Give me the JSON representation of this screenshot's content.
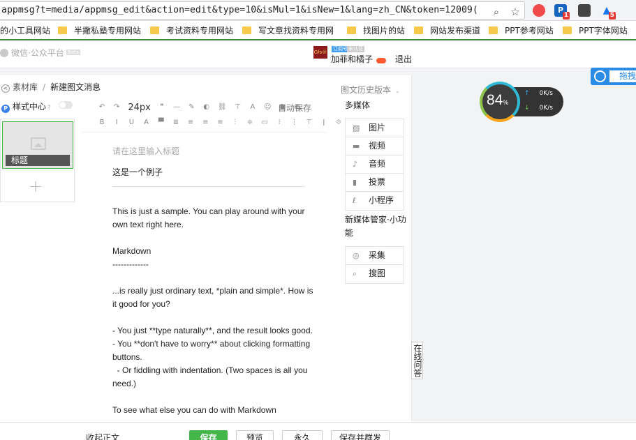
{
  "browser": {
    "url": "appmsg?t=media/appmsg_edit&action=edit&type=10&isMul=1&isNew=1&lang=zh_CN&token=12009(",
    "search_icon": "search-icon",
    "star_icon": "star-icon",
    "ext_p_label": "P",
    "ext_p_badge": "1",
    "ext_a_badge": "5"
  },
  "bookmarks": [
    "的小工具网站",
    "半撇私塾专用网站",
    "考试资料专用网站",
    "写文章找资料专用网",
    "找图片的站",
    "网站发布渠道",
    "PPT参考网站",
    "PPT字体网站"
  ],
  "header": {
    "logo_text": "微信·公众平台",
    "logo_tag": "Beta",
    "avatar_text": "Gfs®",
    "account_tag": "订阅号",
    "account_tag2": "未认证",
    "account_name": "加菲和橘子",
    "logout_label": "退出"
  },
  "breadcrumb": {
    "parent": "素材库",
    "separator": "/",
    "current": "新建图文消息"
  },
  "style_center": {
    "label": "样式中心",
    "help": "?",
    "p_icon": "P"
  },
  "thumbs": {
    "caption": "标题",
    "add": "+"
  },
  "toolbar": {
    "undo": "↶",
    "redo": "↷",
    "font_size": "24px",
    "row1": [
      "❞",
      "—",
      "✎",
      "◐",
      "⛓",
      "⊤",
      "A",
      "☺",
      "▣",
      "⊞"
    ],
    "row2": [
      "B",
      "I",
      "U",
      "A",
      "▀",
      "≣",
      "≡",
      "≡",
      "≡",
      "⫶",
      "≑",
      "▭",
      "⁝",
      "⋮",
      "⊤",
      "ǀ",
      "⟐"
    ],
    "autosave_label": "自动保存"
  },
  "editor": {
    "title_placeholder": "请在这里输入标题",
    "title_value": "这是一个例子",
    "body": "This is just a sample. You can play around with your own text right here.\n\nMarkdown\n-------------\n\n...is really just ordinary text, *plain and simple*. How is it good for you?\n\n- You just **type naturally**, and the result looks good.\n- You **don't have to worry** about clicking formatting buttons.\n  - Or fiddling with indentation. (Two spaces is all you need.)\n\nTo see what else you can do with Markdown"
  },
  "media": {
    "history_label": "图文历史版本",
    "group1_title": "多媒体",
    "group1_items": [
      {
        "label": "图片",
        "icon": "image-icon",
        "glyph": "▨"
      },
      {
        "label": "视频",
        "icon": "video-icon",
        "glyph": "▬"
      },
      {
        "label": "音频",
        "icon": "microphone-icon",
        "glyph": "♪"
      },
      {
        "label": "投票",
        "icon": "poll-icon",
        "glyph": "▮"
      },
      {
        "label": "小程序",
        "icon": "miniprogram-icon",
        "glyph": "ℓ"
      }
    ],
    "group2_title": "新媒体管家·小功能",
    "group2_items": [
      {
        "label": "采集",
        "icon": "collect-icon",
        "glyph": "◎"
      },
      {
        "label": "搜图",
        "icon": "search-image-icon",
        "glyph": "⌕"
      }
    ]
  },
  "online_help_label": "在线问答",
  "footer": {
    "collapse_label": "收起正文",
    "save": "保存",
    "preview": "预览",
    "permanent": "永久",
    "save_and_send": "保存并群发"
  },
  "speed_widget": {
    "percent": "84",
    "percent_unit": "%",
    "up": "0K/s",
    "down": "0K/s"
  },
  "drag_tab_label": "拖拽"
}
